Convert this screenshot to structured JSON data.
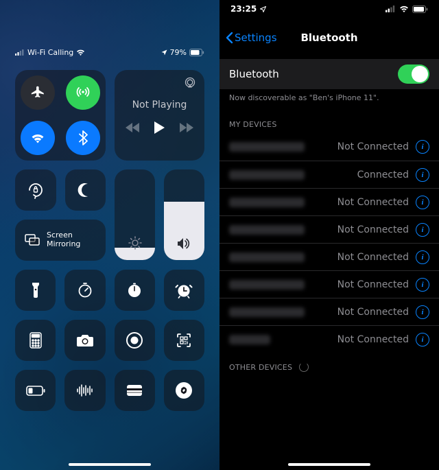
{
  "left": {
    "status": {
      "carrier_label": "Wi-Fi Calling",
      "battery_pct": "79%"
    },
    "connectivity": {
      "airplane": "airplane-icon",
      "cellular": "cell-icon",
      "wifi": "wifi-icon",
      "bluetooth": "bluetooth-icon"
    },
    "media": {
      "now_playing_label": "Not Playing"
    },
    "screen_mirroring_label": "Screen\nMirroring"
  },
  "right": {
    "status": {
      "time": "23:25"
    },
    "nav": {
      "back_label": "Settings",
      "title": "Bluetooth"
    },
    "toggle": {
      "label": "Bluetooth",
      "on": true
    },
    "footer": "Now discoverable as \"Ben's iPhone 11\".",
    "section_my": "MY DEVICES",
    "section_other": "OTHER DEVICES",
    "devices": [
      {
        "status": "Not Connected"
      },
      {
        "status": "Connected"
      },
      {
        "status": "Not Connected"
      },
      {
        "status": "Not Connected"
      },
      {
        "status": "Not Connected"
      },
      {
        "status": "Not Connected"
      },
      {
        "status": "Not Connected"
      },
      {
        "status": "Not Connected"
      }
    ]
  }
}
